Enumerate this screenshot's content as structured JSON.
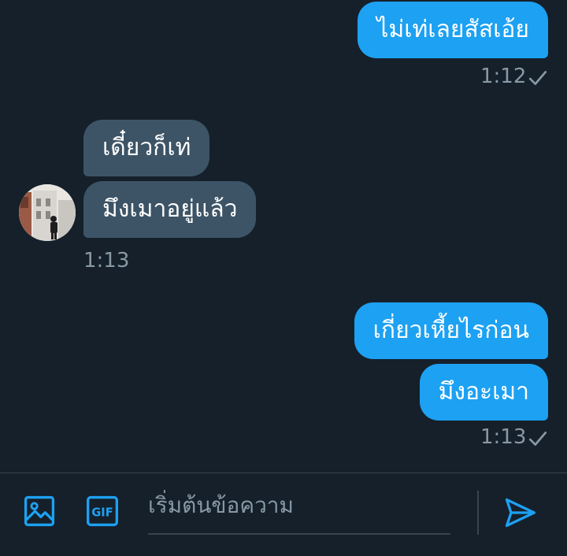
{
  "colors": {
    "background": "#15202b",
    "outgoing_bubble": "#1da1f2",
    "incoming_bubble": "#3d5466",
    "meta_text": "#8899a6",
    "accent": "#1da1f2"
  },
  "messages": [
    {
      "direction": "out",
      "text": "ไม่เท่เลยสัสเอ้ย",
      "timestamp": "1:12",
      "read_icon": "check-icon"
    },
    {
      "direction": "in",
      "text": "เดี๋ยวก็เท่"
    },
    {
      "direction": "in",
      "text": "มึงเมาอยู่แล้ว",
      "timestamp": "1:13"
    },
    {
      "direction": "out",
      "text": "เกี่ยวเหี้ยไรก่อน"
    },
    {
      "direction": "out",
      "text": "มึงอะเมา",
      "timestamp": "1:13",
      "read_icon": "check-icon"
    }
  ],
  "composer": {
    "placeholder": "เริ่มต้นข้อความ",
    "value": "",
    "image_icon": "image-icon",
    "gif_label": "GIF",
    "send_icon": "send-icon"
  }
}
